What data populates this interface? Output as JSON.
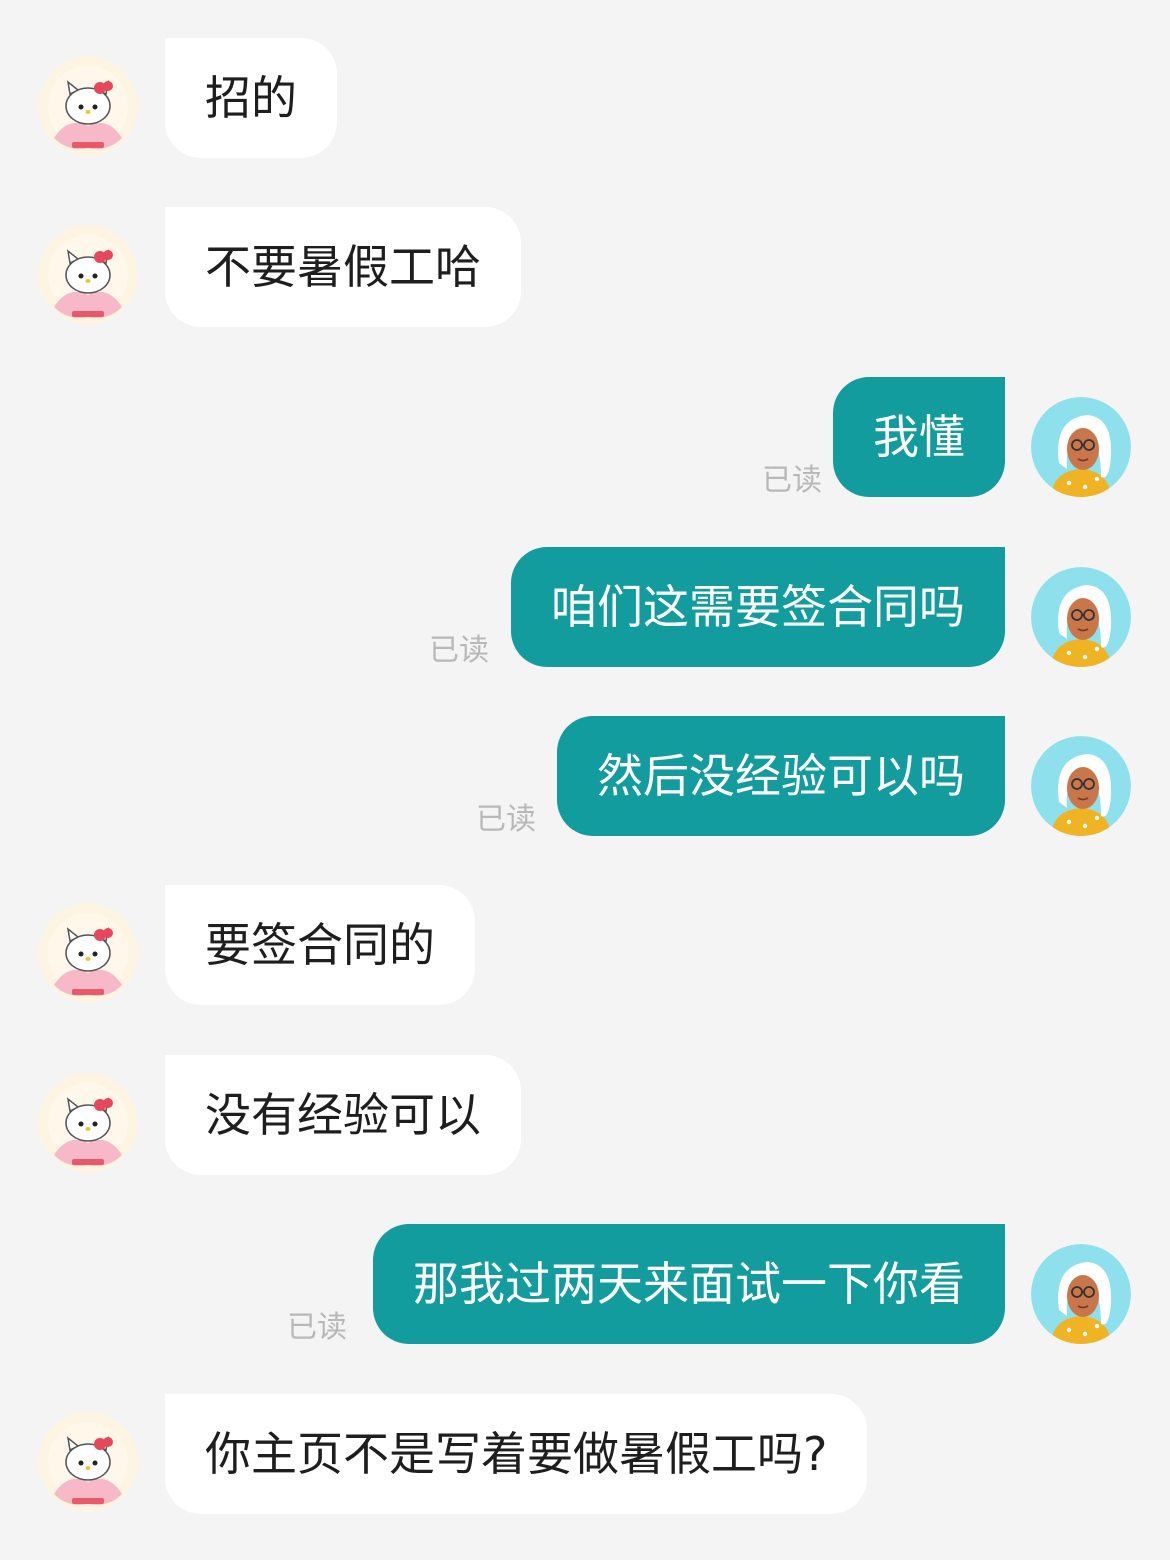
{
  "read_label": "已读",
  "colors": {
    "background": "#f4f4f4",
    "incoming_bubble": "#ffffff",
    "outgoing_bubble": "#129c9e",
    "read_text": "#b8b8b8"
  },
  "icons": {
    "incoming_avatar": "hello-kitty-lotus-avatar",
    "outgoing_avatar": "woman-with-glasses-avatar"
  },
  "messages": [
    {
      "side": "left",
      "text": "招的"
    },
    {
      "side": "left",
      "text": "不要暑假工哈"
    },
    {
      "side": "right",
      "text": "我懂"
    },
    {
      "side": "right",
      "text": "咱们这需要签合同吗"
    },
    {
      "side": "right",
      "text": "然后没经验可以吗"
    },
    {
      "side": "left",
      "text": "要签合同的"
    },
    {
      "side": "left",
      "text": "没有经验可以"
    },
    {
      "side": "right",
      "text": "那我过两天来面试一下你看"
    },
    {
      "side": "left",
      "text": "你主页不是写着要做暑假工吗?"
    }
  ]
}
